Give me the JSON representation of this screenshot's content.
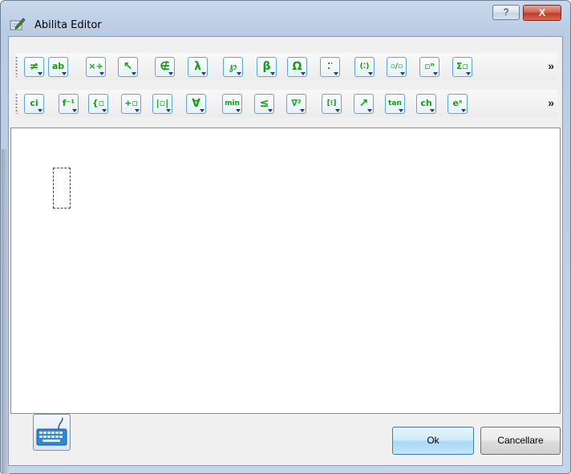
{
  "window": {
    "title": "Abilita Editor",
    "help_label": "?",
    "close_label": "X"
  },
  "toolbar_row_1": [
    {
      "label": "≠",
      "icon": "not-equal-icon"
    },
    {
      "label": "ab",
      "icon": "text-format-icon"
    },
    {
      "label": "×÷",
      "icon": "arithmetic-icon"
    },
    {
      "label": "↖",
      "icon": "arrow-icon"
    },
    {
      "label": "∉",
      "icon": "not-element-icon"
    },
    {
      "label": "λ",
      "icon": "lambda-icon"
    },
    {
      "label": "℘",
      "icon": "script-letters-icon"
    },
    {
      "label": "β",
      "icon": "greek-lowercase-icon"
    },
    {
      "label": "Ω",
      "icon": "greek-uppercase-icon"
    },
    {
      "label": "⁚′",
      "icon": "prime-icon"
    },
    {
      "label": "(⁚)",
      "icon": "parentheses-icon"
    },
    {
      "label": "▫/▫",
      "icon": "fraction-icon"
    },
    {
      "label": "▫ⁿ",
      "icon": "superscript-icon"
    },
    {
      "label": "Σ▫",
      "icon": "sum-icon"
    }
  ],
  "toolbar_row_2": [
    {
      "label": "ci",
      "icon": "identifier-icon"
    },
    {
      "label": "f⁻¹",
      "icon": "inverse-function-icon"
    },
    {
      "label": "{▫",
      "icon": "piecewise-icon"
    },
    {
      "label": "+▫",
      "icon": "plus-placeholder-icon"
    },
    {
      "label": "|▫|",
      "icon": "absolute-value-icon"
    },
    {
      "label": "∀",
      "icon": "for-all-icon"
    },
    {
      "label": "min",
      "icon": "min-icon"
    },
    {
      "label": "≤",
      "icon": "less-equal-icon"
    },
    {
      "label": "∇²",
      "icon": "nabla-icon"
    },
    {
      "label": "[⁝]",
      "icon": "matrix-icon"
    },
    {
      "label": "↗",
      "icon": "vector-arrow-icon"
    },
    {
      "label": "tan",
      "icon": "trig-icon"
    },
    {
      "label": "ch",
      "icon": "hyperbolic-icon"
    },
    {
      "label": "eˣ",
      "icon": "exponential-icon"
    }
  ],
  "overflow_label": "»",
  "buttons": {
    "ok": "Ok",
    "cancel": "Cancellare"
  },
  "colors": {
    "symbol_green": "#12a012",
    "button_border_blue": "#5ca7dd",
    "close_red": "#c2392a"
  }
}
